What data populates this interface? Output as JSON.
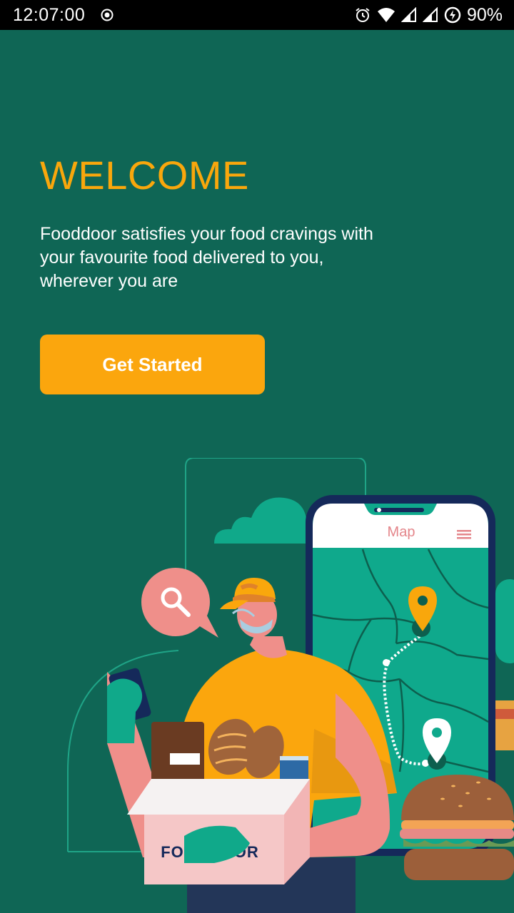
{
  "status_bar": {
    "time": "12:07:00",
    "battery": "90%"
  },
  "welcome": {
    "title": "WELCOME",
    "description": "Fooddoor satisfies your food cravings with your favourite food delivered to you, wherever you are",
    "cta_label": "Get Started"
  },
  "illustration": {
    "phone_header": "Map",
    "box_label": "FOODDOOR"
  },
  "colors": {
    "background": "#0f6655",
    "accent": "#f9a70c",
    "button": "#fba60d"
  },
  "icons": [
    "record-icon",
    "alarm-icon",
    "wifi-icon",
    "signal-icon",
    "battery-saver-icon",
    "search-icon",
    "menu-icon",
    "map-pin-icon"
  ]
}
